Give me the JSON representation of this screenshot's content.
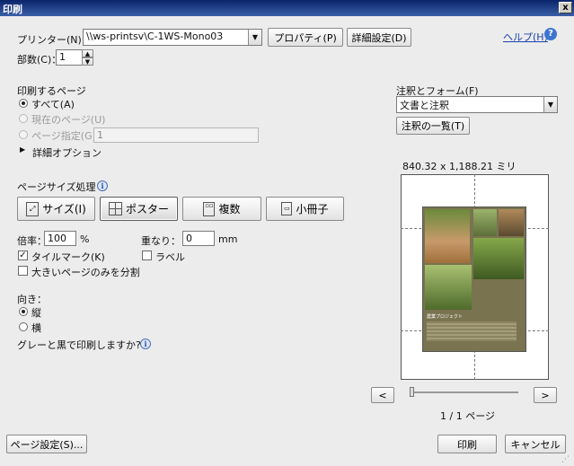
{
  "window": {
    "title": "印刷",
    "close": "x"
  },
  "printer": {
    "label": "プリンター(N)：",
    "value": "\\\\ws-printsv\\C-1WS-Mono03",
    "properties_button": "プロパティ(P)",
    "advanced_button": "詳細設定(D)",
    "help_link": "ヘルプ(H)"
  },
  "copies": {
    "label": "部数(C)：",
    "value": "1"
  },
  "pages": {
    "heading": "印刷するページ",
    "all": "すべて(A)",
    "current": "現在のページ(U)",
    "range": "ページ指定(G)",
    "range_value": "1",
    "more_options": "詳細オプション"
  },
  "page_size": {
    "heading": "ページサイズ処理",
    "tabs": [
      "サイズ(I)",
      "ポスター",
      "複数",
      "小冊子"
    ],
    "selected": "ポスター"
  },
  "poster": {
    "scale_label": "倍率：",
    "scale_value": "100",
    "scale_unit": "%",
    "overlap_label": "重なり：",
    "overlap_value": "0",
    "overlap_unit": "mm",
    "tile_marks": "タイルマーク(K)",
    "tile_marks_checked": true,
    "labels": "ラベル",
    "labels_checked": false,
    "large_pages_only": "大きいページのみを分割",
    "large_pages_checked": false
  },
  "orientation": {
    "heading": "向き：",
    "portrait": "縦",
    "landscape": "横",
    "selected": "縦"
  },
  "gray_print": "グレーと黒で印刷しますか?",
  "comments": {
    "heading": "注釈とフォーム(F)",
    "value": "文書と注釈",
    "summary_button": "注釈の一覧(T)"
  },
  "preview": {
    "size": "840.32 x 1,188.21 ミリ",
    "prev": "<",
    "next": ">",
    "page_indicator": "1 / 1 ページ",
    "thumb_texts": [
      "農業プロジェクト"
    ]
  },
  "footer": {
    "page_setup": "ページ設定(S)...",
    "print": "印刷",
    "cancel": "キャンセル"
  },
  "colors": {
    "accent_link": "#1a3fb0",
    "title_bar": "#0a246a"
  },
  "icons": [
    "close-icon",
    "dropdown-arrow-icon",
    "spin-up-icon",
    "spin-down-icon",
    "help-icon",
    "info-icon",
    "expand-triangle-icon",
    "size-icon",
    "poster-icon",
    "multiple-icon",
    "booklet-icon"
  ]
}
